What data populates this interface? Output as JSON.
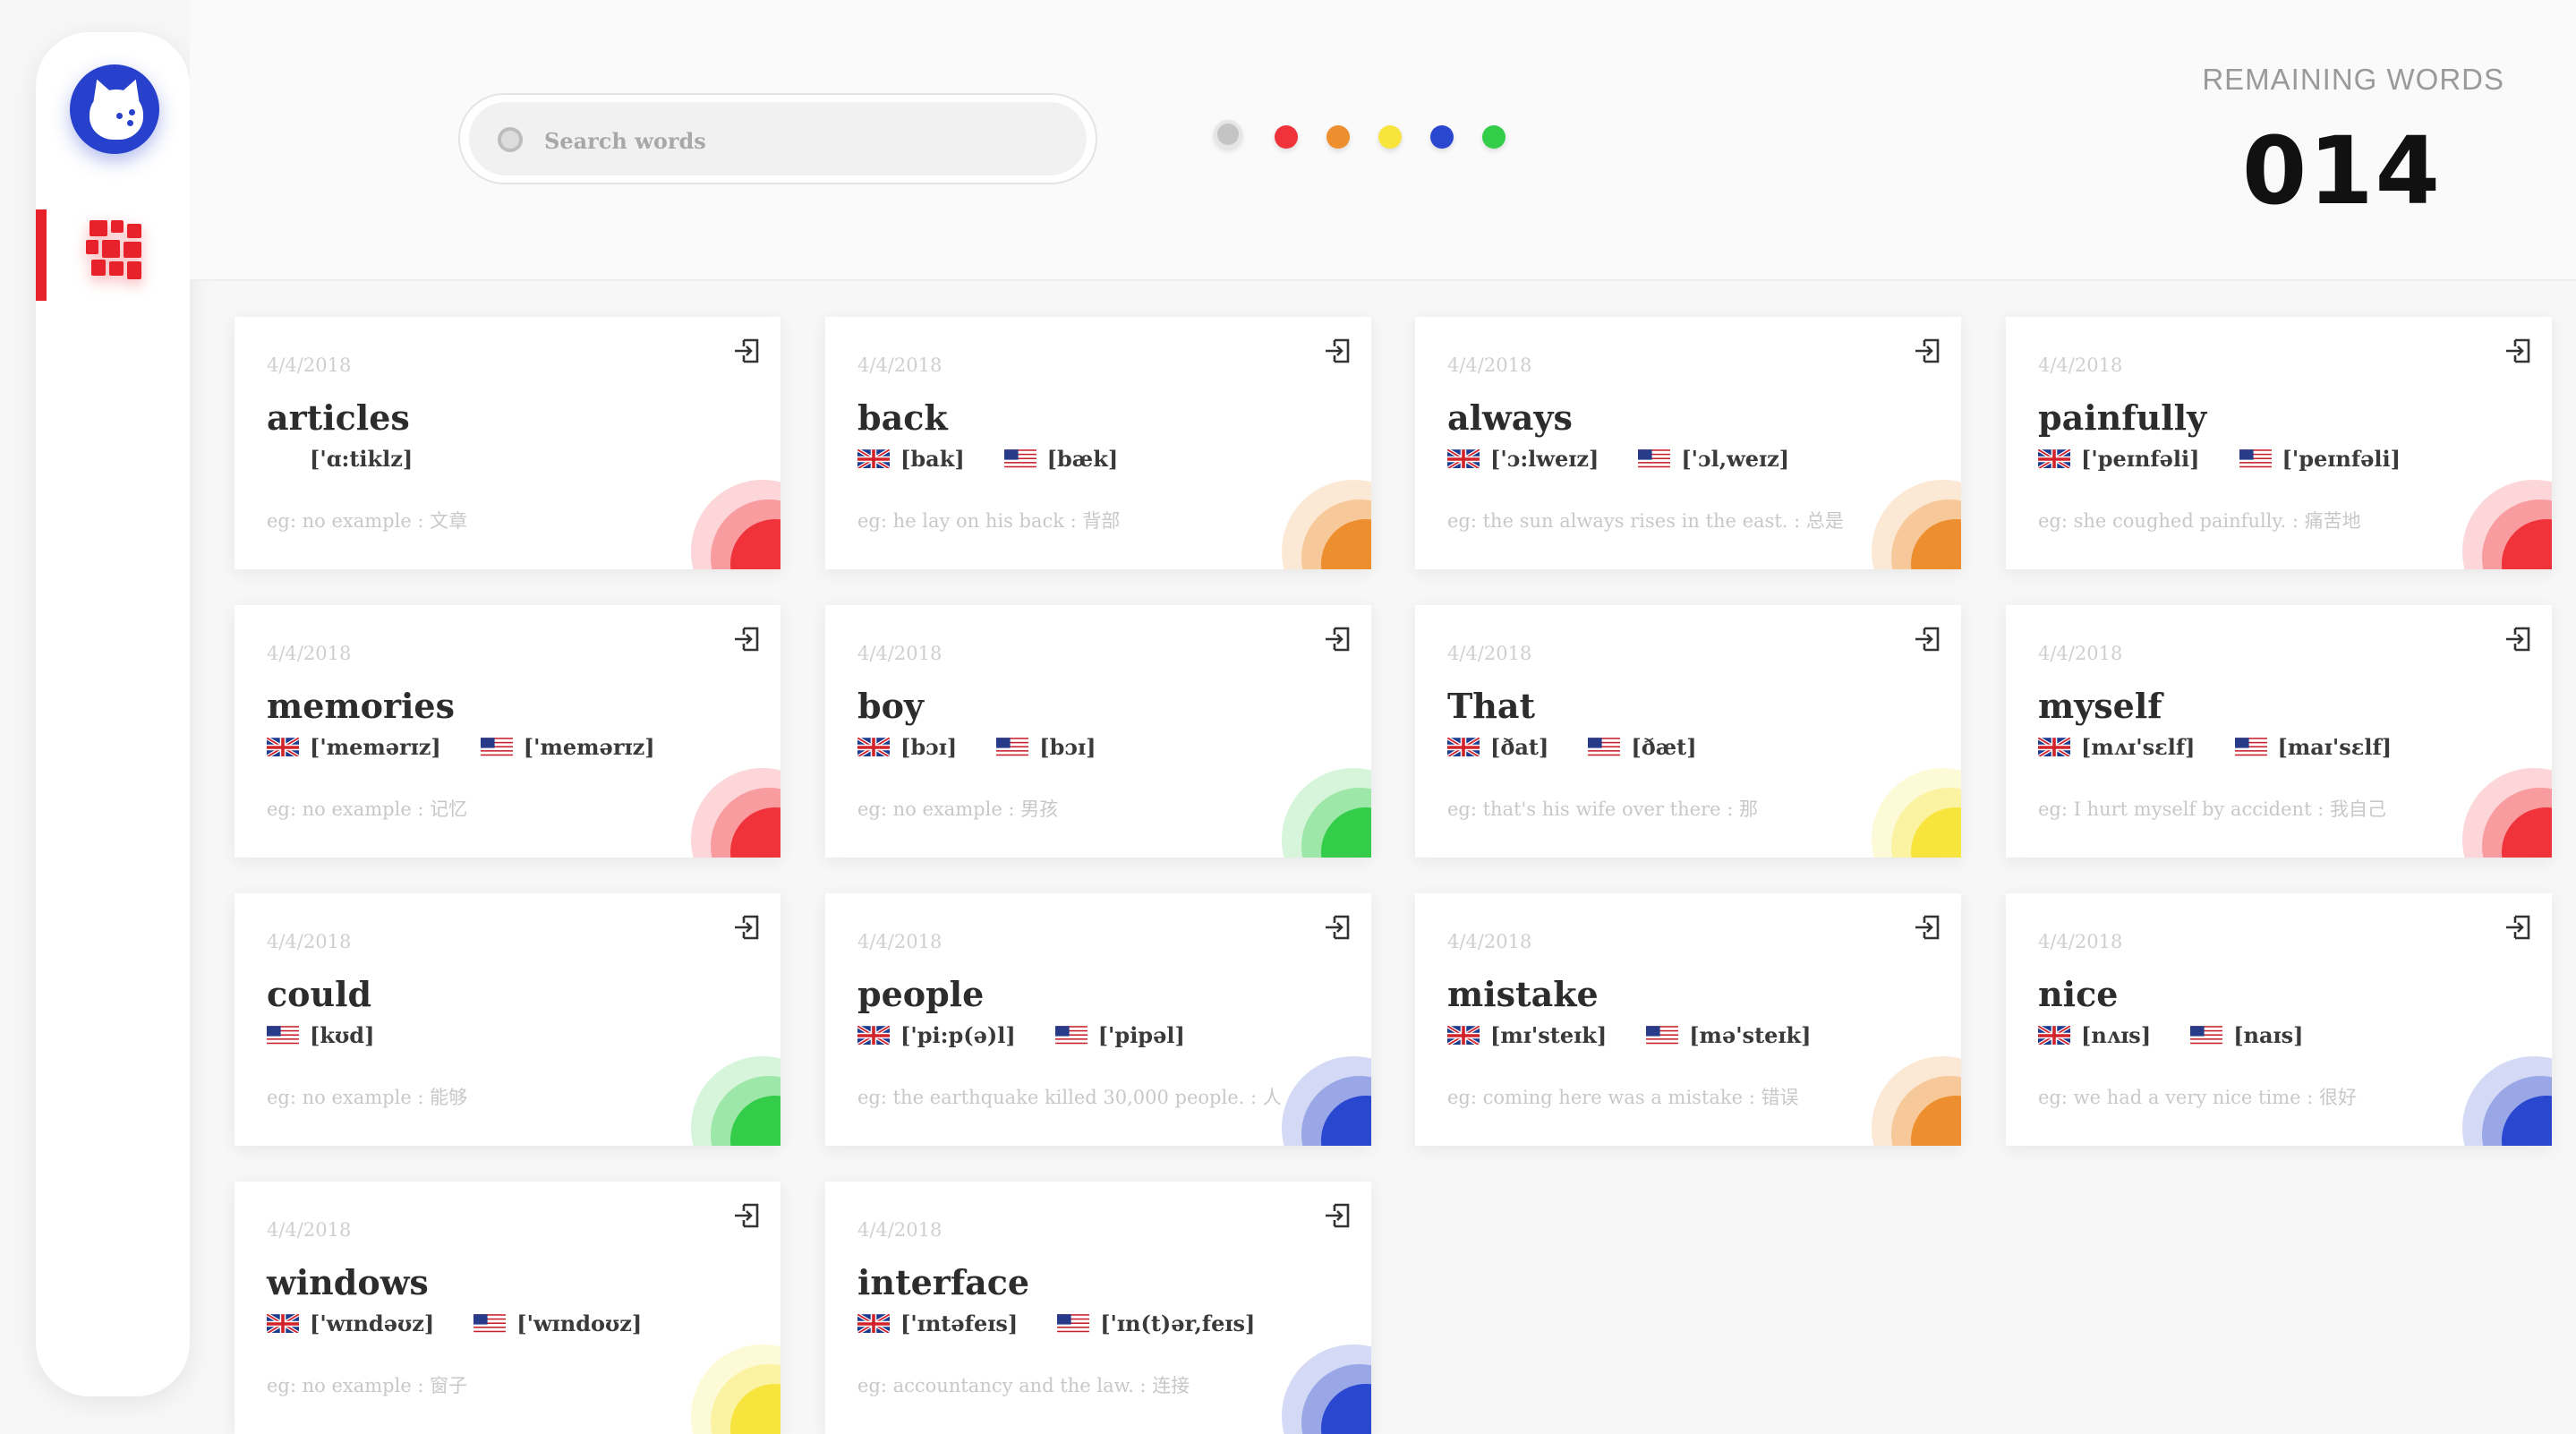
{
  "search": {
    "placeholder": "Search words"
  },
  "filters": [
    {
      "name": "all",
      "color": "#c4c4c4"
    },
    {
      "name": "red",
      "color": "#f0323a"
    },
    {
      "name": "orange",
      "color": "#ee8f2f"
    },
    {
      "name": "yellow",
      "color": "#f7e43c"
    },
    {
      "name": "blue",
      "color": "#2a47cf"
    },
    {
      "name": "green",
      "color": "#33cd4a"
    }
  ],
  "remaining": {
    "label": "REMAINING WORDS",
    "count": "014"
  },
  "icons": {
    "logo": "cat-logo-icon",
    "nav": "grid-icon",
    "enter": "enter-icon",
    "uk": "uk-flag-icon",
    "us": "us-flag-icon"
  },
  "cards": [
    {
      "date": "4/4/2018",
      "word": "articles",
      "pron": [
        {
          "flag": "",
          "text": "['ɑ:tiklz]"
        }
      ],
      "example": "eg: no example : 文章",
      "color": "#f0323a"
    },
    {
      "date": "4/4/2018",
      "word": "back",
      "pron": [
        {
          "flag": "uk",
          "text": "[bak]"
        },
        {
          "flag": "us",
          "text": "[bæk]"
        }
      ],
      "example": "eg: he lay on his back : 背部",
      "color": "#ee8f2f"
    },
    {
      "date": "4/4/2018",
      "word": "always",
      "pron": [
        {
          "flag": "uk",
          "text": "['ɔ:lweɪz]"
        },
        {
          "flag": "us",
          "text": "['ɔl,weɪz]"
        }
      ],
      "example": "eg: the sun always rises in the east. : 总是",
      "color": "#ee8f2f"
    },
    {
      "date": "4/4/2018",
      "word": "painfully",
      "pron": [
        {
          "flag": "uk",
          "text": "['peɪnfəli]"
        },
        {
          "flag": "us",
          "text": "['peɪnfəli]"
        }
      ],
      "example": "eg: she coughed painfully. : 痛苦地",
      "color": "#f0323a"
    },
    {
      "date": "4/4/2018",
      "word": "memories",
      "pron": [
        {
          "flag": "uk",
          "text": "['memərɪz]"
        },
        {
          "flag": "us",
          "text": "['memərɪz]"
        }
      ],
      "example": "eg: no example : 记忆",
      "color": "#f0323a"
    },
    {
      "date": "4/4/2018",
      "word": "boy",
      "pron": [
        {
          "flag": "uk",
          "text": "[bɔɪ]"
        },
        {
          "flag": "us",
          "text": "[bɔɪ]"
        }
      ],
      "example": "eg: no example : 男孩",
      "color": "#33cd4a"
    },
    {
      "date": "4/4/2018",
      "word": "That",
      "pron": [
        {
          "flag": "uk",
          "text": "[ðat]"
        },
        {
          "flag": "us",
          "text": "[ðæt]"
        }
      ],
      "example": "eg: that's his wife over there : 那",
      "color": "#f7e43c"
    },
    {
      "date": "4/4/2018",
      "word": "myself",
      "pron": [
        {
          "flag": "uk",
          "text": "[mʌɪ'sɛlf]"
        },
        {
          "flag": "us",
          "text": "[maɪ'sɛlf]"
        }
      ],
      "example": "eg: I hurt myself by accident : 我自己",
      "color": "#f0323a"
    },
    {
      "date": "4/4/2018",
      "word": "could",
      "pron": [
        {
          "flag": "us",
          "text": "[kʊd]"
        }
      ],
      "example": "eg: no example : 能够",
      "color": "#33cd4a"
    },
    {
      "date": "4/4/2018",
      "word": "people",
      "pron": [
        {
          "flag": "uk",
          "text": "['pi:p(ə)l]"
        },
        {
          "flag": "us",
          "text": "['pipəl]"
        }
      ],
      "example": "eg: the earthquake killed 30,000 people. : 人",
      "color": "#2a47cf"
    },
    {
      "date": "4/4/2018",
      "word": "mistake",
      "pron": [
        {
          "flag": "uk",
          "text": "[mɪ'steɪk]"
        },
        {
          "flag": "us",
          "text": "[mə'steɪk]"
        }
      ],
      "example": "eg: coming here was a mistake : 错误",
      "color": "#ee8f2f"
    },
    {
      "date": "4/4/2018",
      "word": "nice",
      "pron": [
        {
          "flag": "uk",
          "text": "[nʌɪs]"
        },
        {
          "flag": "us",
          "text": "[naɪs]"
        }
      ],
      "example": "eg: we had a very nice time : 很好",
      "color": "#2a47cf"
    },
    {
      "date": "4/4/2018",
      "word": "windows",
      "pron": [
        {
          "flag": "uk",
          "text": "['wɪndəʊz]"
        },
        {
          "flag": "us",
          "text": "['wɪndoʊz]"
        }
      ],
      "example": "eg: no example : 窗子",
      "color": "#f7e43c"
    },
    {
      "date": "4/4/2018",
      "word": "interface",
      "pron": [
        {
          "flag": "uk",
          "text": "['ɪntəfeɪs]"
        },
        {
          "flag": "us",
          "text": "['ɪn(t)ər,feɪs]"
        }
      ],
      "example": "eg: accountancy and the law. : 连接",
      "color": "#2a47cf"
    }
  ]
}
